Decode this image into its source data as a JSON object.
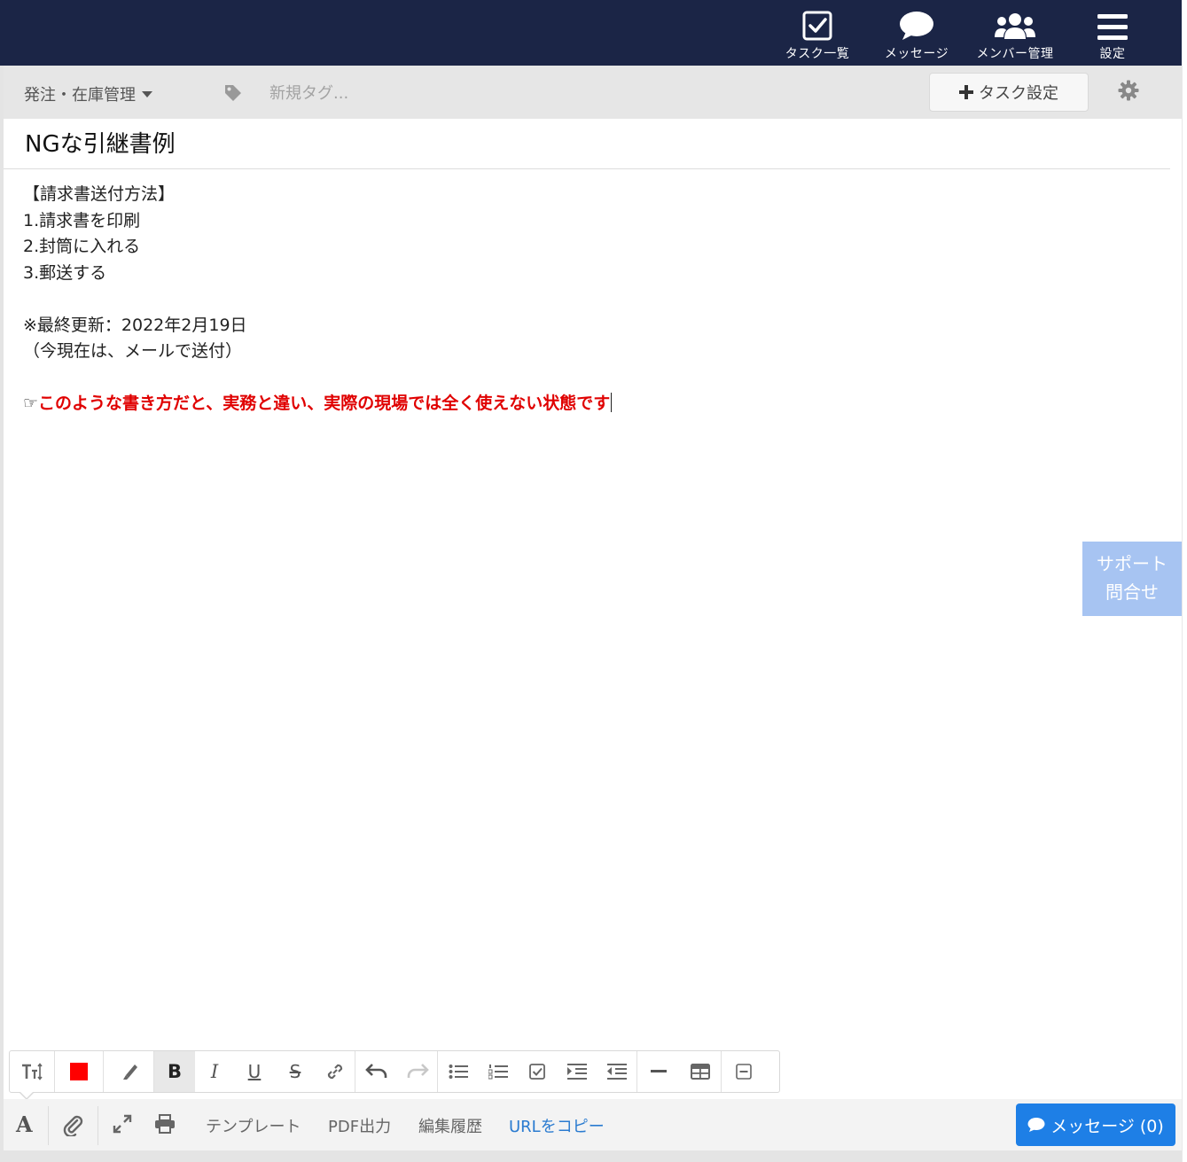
{
  "nav": {
    "items": [
      {
        "label": "タスク一覧",
        "icon": "task-list-icon"
      },
      {
        "label": "メッセージ",
        "icon": "message-icon"
      },
      {
        "label": "メンバー管理",
        "icon": "members-icon"
      },
      {
        "label": "設定",
        "icon": "menu-icon"
      }
    ]
  },
  "subbar": {
    "project": "発注・在庫管理",
    "tag_placeholder": "新規タグ...",
    "task_settings_label": "タスク設定"
  },
  "document": {
    "title": "NGな引継書例",
    "lines": [
      "【請求書送付方法】",
      "1.請求書を印刷",
      "2.封筒に入れる",
      "3.郵送する",
      "",
      "※最終更新：2022年2月19日",
      "（今現在は、メールで送付）",
      ""
    ],
    "note_prefix": "☞",
    "note_text": "このような書き方だと、実務と違い、実際の現場では全く使えない状態です"
  },
  "support": {
    "line1": "サポート",
    "line2": "問合せ"
  },
  "format_toolbar": {
    "active_color": "#ff0000",
    "bold_label": "B",
    "italic_label": "I",
    "underline_label": "U",
    "strike_label": "S"
  },
  "bottombar": {
    "font_label": "A",
    "template": "テンプレート",
    "pdf": "PDF出力",
    "history": "編集履歴",
    "copy_url": "URLをコピー",
    "message_button": "メッセージ (0)"
  },
  "colors": {
    "nav_bg": "#1b2546",
    "accent_blue": "#1e7fe6",
    "link_blue": "#2a7bd0",
    "note_red": "#e00000",
    "support_bg": "#a7c4f2"
  }
}
